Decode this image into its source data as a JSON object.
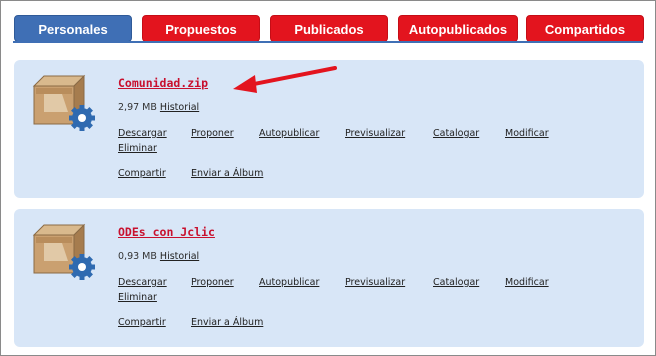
{
  "tabs": [
    {
      "label": "Personales",
      "active": true
    },
    {
      "label": "Propuestos",
      "active": false
    },
    {
      "label": "Publicados",
      "active": false
    },
    {
      "label": "Autopublicados",
      "active": false
    },
    {
      "label": "Compartidos",
      "active": false
    }
  ],
  "colors": {
    "tab_red": "#e3141e",
    "tab_blue": "#3f6fb5",
    "card_bg": "#d8e6f7",
    "title_red": "#c8102e",
    "arrow": "#e3141e"
  },
  "items": [
    {
      "title": "Comunidad.zip",
      "size": "2,97 MB",
      "history_label": "Historial",
      "actions": [
        "Descargar",
        "Proponer",
        "Autopublicar",
        "Previsualizar",
        "Catalogar",
        "Modificar",
        "Eliminar",
        "Compartir",
        "Enviar a Álbum"
      ],
      "icon": "package-gear-icon"
    },
    {
      "title": "ODEs con Jclic",
      "size": "0,93 MB",
      "history_label": "Historial",
      "actions": [
        "Descargar",
        "Proponer",
        "Autopublicar",
        "Previsualizar",
        "Catalogar",
        "Modificar",
        "Eliminar",
        "Compartir",
        "Enviar a Álbum"
      ],
      "icon": "package-gear-icon"
    }
  ]
}
